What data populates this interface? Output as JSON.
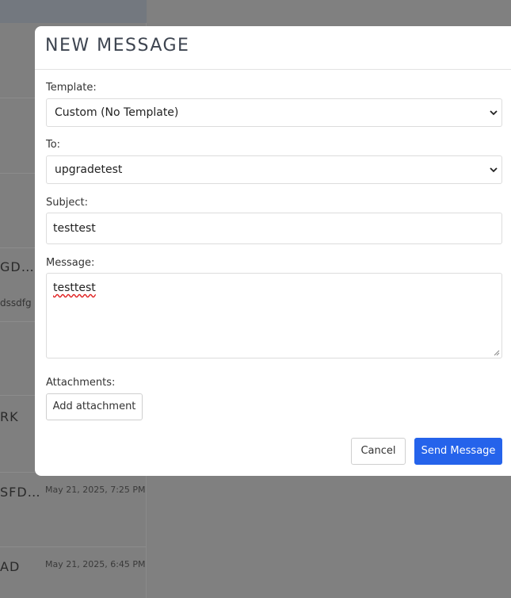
{
  "background": {
    "rows": [
      {
        "title": "",
        "sub": "",
        "time": ""
      },
      {
        "title": "",
        "sub": "",
        "time": ""
      },
      {
        "title": "",
        "sub": "",
        "time": ""
      },
      {
        "title": "GD…",
        "sub": "dssdfg",
        "time": ""
      },
      {
        "title": "",
        "sub": "",
        "time": ""
      },
      {
        "title": "RK",
        "sub": "",
        "time": ""
      },
      {
        "title": "SFD…",
        "sub": "",
        "time": "May 21, 2025, 7:25 PM"
      },
      {
        "title": "AD",
        "sub": "",
        "time": "May 21, 2025, 6:45 PM"
      }
    ]
  },
  "modal": {
    "title": "NEW MESSAGE",
    "template": {
      "label": "Template:",
      "value": "Custom (No Template)"
    },
    "to": {
      "label": "To:",
      "value": "upgradetest"
    },
    "subject": {
      "label": "Subject:",
      "value": "testtest"
    },
    "message": {
      "label": "Message:",
      "value": "testtest"
    },
    "attachments": {
      "label": "Attachments:",
      "button": "Add attachment"
    },
    "cancel_label": "Cancel",
    "send_label": "Send Message"
  },
  "colors": {
    "primary": "#2563eb",
    "overlay": "#7f7f7f"
  }
}
